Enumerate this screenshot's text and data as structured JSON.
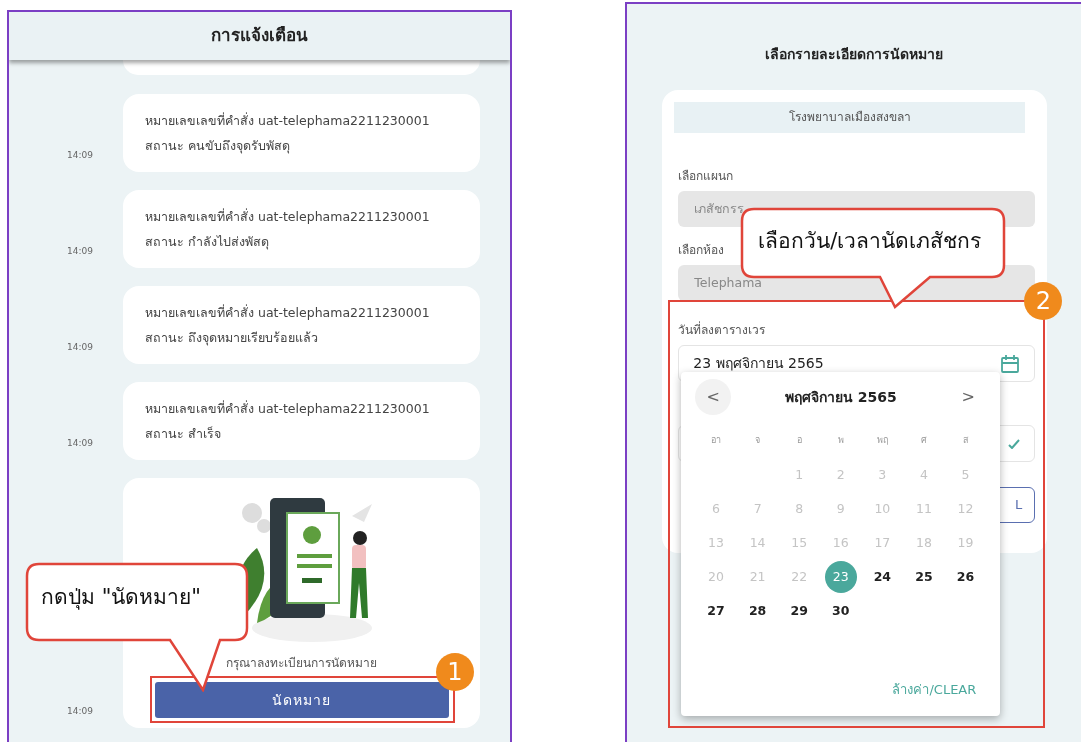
{
  "left_screen": {
    "title": "การแจ้งเตือน",
    "notifications": [
      {
        "line1": "หมายเลขเลขที่คำสั่ง uat-telephama2211230001",
        "line2": "สถานะ คนขับถึงจุดรับพัสดุ",
        "time": "14:09"
      },
      {
        "line1": "หมายเลขเลขที่คำสั่ง uat-telephama2211230001",
        "line2": "สถานะ กำลังไปส่งพัสดุ",
        "time": "14:09"
      },
      {
        "line1": "หมายเลขเลขที่คำสั่ง uat-telephama2211230001",
        "line2": "สถานะ ถึงจุดหมายเรียบร้อยแล้ว",
        "time": "14:09"
      },
      {
        "line1": "หมายเลขเลขที่คำสั่ง uat-telephama2211230001",
        "line2": "สถานะ สำเร็จ",
        "time": "14:09"
      }
    ],
    "appointment_card": {
      "prompt": "กรุณาลงทะเบียนการนัดหมาย",
      "button": "นัดหมาย",
      "time": "14:09"
    },
    "callout": {
      "text": "กดปุ่ม \"นัดหมาย\"",
      "step": "1"
    }
  },
  "right_screen": {
    "title": "เลือกรายละเอียดการนัดหมาย",
    "hospital": "โรงพยาบาลเมืองสงขลา",
    "department": {
      "label": "เลือกแผนก",
      "value": "เภสัชกรร"
    },
    "room": {
      "label": "เลือกห้อง",
      "value": "Telephama"
    },
    "date": {
      "label": "วันที่ลงตารางเวร",
      "value": "23 พฤศจิกายน 2565"
    },
    "cancel_button_visible": "L",
    "calendar": {
      "month": "พฤศจิกายน 2565",
      "prev": "<",
      "next": ">",
      "weekdays": [
        "อา",
        "จ",
        "อ",
        "พ",
        "พฤ",
        "ศ",
        "ส"
      ],
      "weeks": [
        {
          "days": [
            {
              "day": "1",
              "disabled": true,
              "selected": false
            },
            {
              "day": "2",
              "disabled": true,
              "selected": false
            },
            {
              "day": "3",
              "disabled": true,
              "selected": false
            },
            {
              "day": "4",
              "disabled": true,
              "selected": false
            },
            {
              "day": "5",
              "disabled": true,
              "selected": false
            }
          ]
        },
        {
          "days": [
            {
              "day": "6",
              "disabled": true,
              "selected": false
            },
            {
              "day": "7",
              "disabled": true,
              "selected": false
            },
            {
              "day": "8",
              "disabled": true,
              "selected": false
            },
            {
              "day": "9",
              "disabled": true,
              "selected": false
            },
            {
              "day": "10",
              "disabled": true,
              "selected": false
            },
            {
              "day": "11",
              "disabled": true,
              "selected": false
            },
            {
              "day": "12",
              "disabled": true,
              "selected": false
            }
          ]
        },
        {
          "days": [
            {
              "day": "13",
              "disabled": true,
              "selected": false
            },
            {
              "day": "14",
              "disabled": true,
              "selected": false
            },
            {
              "day": "15",
              "disabled": true,
              "selected": false
            },
            {
              "day": "16",
              "disabled": true,
              "selected": false
            },
            {
              "day": "17",
              "disabled": true,
              "selected": false
            },
            {
              "day": "18",
              "disabled": true,
              "selected": false
            },
            {
              "day": "19",
              "disabled": true,
              "selected": false
            }
          ]
        },
        {
          "days": [
            {
              "day": "20",
              "disabled": true,
              "selected": false
            },
            {
              "day": "21",
              "disabled": true,
              "selected": false
            },
            {
              "day": "22",
              "disabled": true,
              "selected": false
            },
            {
              "day": "23",
              "disabled": false,
              "selected": true
            },
            {
              "day": "24",
              "disabled": false,
              "selected": false
            },
            {
              "day": "25",
              "disabled": false,
              "selected": false
            },
            {
              "day": "26",
              "disabled": false,
              "selected": false
            }
          ]
        },
        {
          "days": [
            {
              "day": "27",
              "disabled": false,
              "selected": false
            },
            {
              "day": "28",
              "disabled": false,
              "selected": false
            },
            {
              "day": "29",
              "disabled": false,
              "selected": false
            },
            {
              "day": "30",
              "disabled": false,
              "selected": false
            }
          ]
        }
      ],
      "clear": "ล้างค่า/CLEAR"
    },
    "callout": {
      "text": "เลือกวัน/เวลานัดเภสัชกร",
      "step": "2"
    }
  }
}
